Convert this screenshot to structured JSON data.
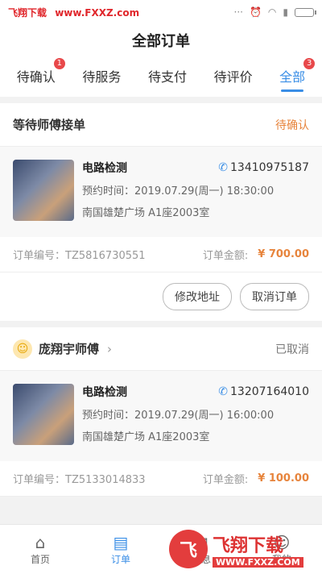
{
  "status_bar": {
    "watermark_left": "飞翔下载",
    "watermark_site": "www.FXXZ.com",
    "dots": "···"
  },
  "header": {
    "title": "全部订单"
  },
  "tabs": [
    {
      "label": "待确认",
      "badge": "1"
    },
    {
      "label": "待服务"
    },
    {
      "label": "待支付"
    },
    {
      "label": "待评价"
    },
    {
      "label": "全部",
      "badge": "3",
      "active": true
    }
  ],
  "orders": [
    {
      "header_text": "等待师傅接单",
      "status": "待确认",
      "service": "电路检测",
      "phone": "13410975187",
      "appointment": "预约时间：2019.07.29(周一) 18:30:00",
      "address": "南国雄楚广场 A1座2003室",
      "order_no": "订单编号：TZ5816730551",
      "amount_label": "订单金额:",
      "amount": "¥ 700.00",
      "buttons": [
        "修改地址",
        "取消订单"
      ]
    },
    {
      "header_text": "庞翔宇师傅",
      "status": "已取消",
      "service": "电路检测",
      "phone": "13207164010",
      "appointment": "预约时间：2019.07.29(周一) 16:00:00",
      "address": "南国雄楚广场 A1座2003室",
      "order_no": "订单编号：TZ5133014833",
      "amount_label": "订单金额:",
      "amount": "¥ 100.00"
    }
  ],
  "bottom_nav": [
    {
      "label": "首页",
      "icon": "home-icon"
    },
    {
      "label": "订单",
      "icon": "order-icon",
      "active": true
    },
    {
      "label": "消息",
      "icon": "message-icon"
    },
    {
      "label": "我的",
      "icon": "profile-icon"
    }
  ],
  "watermark_logo": {
    "big": "飞翔下载",
    "small": "WWW.FXXZ.COM"
  },
  "colors": {
    "accent": "#3a8ee6",
    "pending": "#e7843c",
    "badge": "#e8484a"
  }
}
